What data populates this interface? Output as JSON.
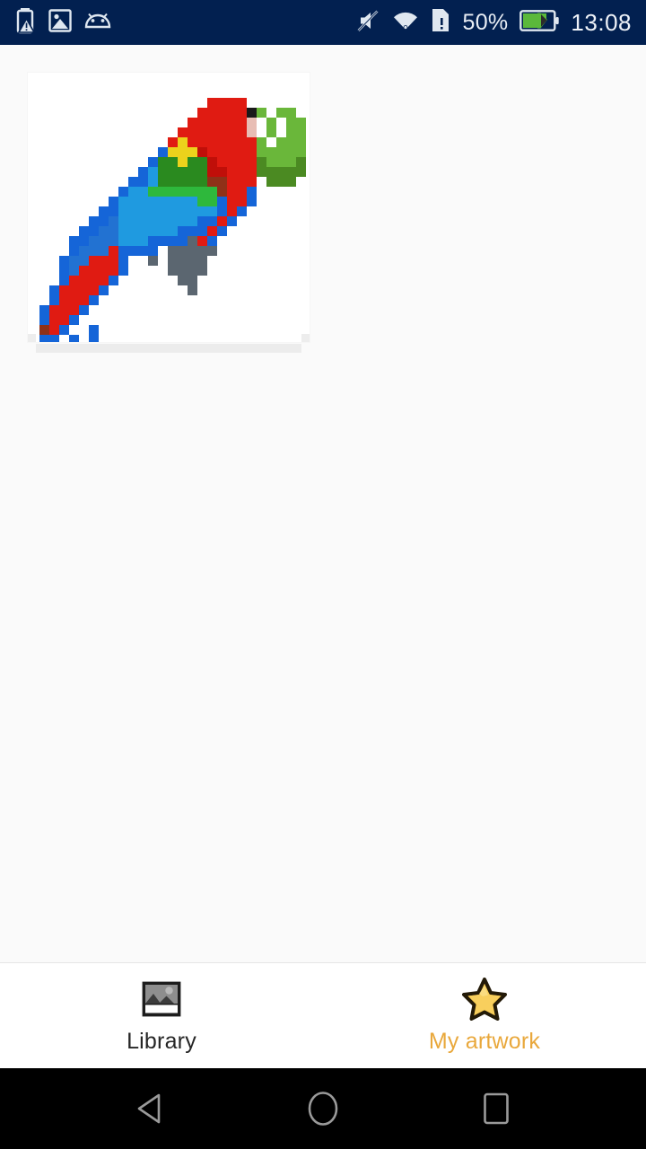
{
  "status_bar": {
    "background_color": "#022050",
    "text_color": "#e9eef5",
    "battery_percent": "50%",
    "clock": "13:08",
    "left_icons": [
      {
        "name": "battery-warning-icon",
        "label": "Battery warning"
      },
      {
        "name": "screenshot-image-icon",
        "label": "Screenshot saved"
      },
      {
        "name": "android-robot-icon",
        "label": "Android system"
      }
    ],
    "right_icons": [
      {
        "name": "volume-mute-icon",
        "label": "Silent mode"
      },
      {
        "name": "wifi-icon",
        "label": "Wi-Fi connected"
      },
      {
        "name": "sim-card-alert-icon",
        "label": "No SIM card"
      },
      {
        "name": "battery-charging-icon",
        "label": "Battery charging",
        "color": "#5bb83b"
      }
    ]
  },
  "main": {
    "background_color": "#fafafa",
    "artworks": [
      {
        "title": "Macaw parrot pixel art",
        "canvas_background": "#ffffff",
        "palette": {
          "red": "#e01b12",
          "dark_red": "#c00f09",
          "brown_red": "#8f3118",
          "blue": "#1565d8",
          "light_blue": "#1f9ae0",
          "mid_blue": "#2272d2",
          "green": "#2a8a1f",
          "bright_green": "#2eb83c",
          "leaf_green": "#6ab73a",
          "dark_green": "#4b8a22",
          "yellow": "#ecd21c",
          "gray": "#5b6670",
          "light_gray": "#9aa3ab",
          "pink": "#e8bdb4",
          "black": "#1a1a1a",
          "white": "#ffffff"
        }
      }
    ]
  },
  "tab_bar": {
    "background_color": "#ffffff",
    "active_color": "#e9a83c",
    "inactive_color": "#262626",
    "tabs": [
      {
        "id": "library",
        "label": "Library",
        "icon": "gallery-photo-icon",
        "active": false
      },
      {
        "id": "my-artwork",
        "label": "My artwork",
        "icon": "star-icon",
        "active": true
      }
    ]
  },
  "nav_bar": {
    "background_color": "#000000",
    "buttons": [
      {
        "id": "back",
        "icon": "back-triangle-icon",
        "label": "Back"
      },
      {
        "id": "home",
        "icon": "home-circle-icon",
        "label": "Home"
      },
      {
        "id": "recents",
        "icon": "recents-square-icon",
        "label": "Recents"
      }
    ]
  }
}
